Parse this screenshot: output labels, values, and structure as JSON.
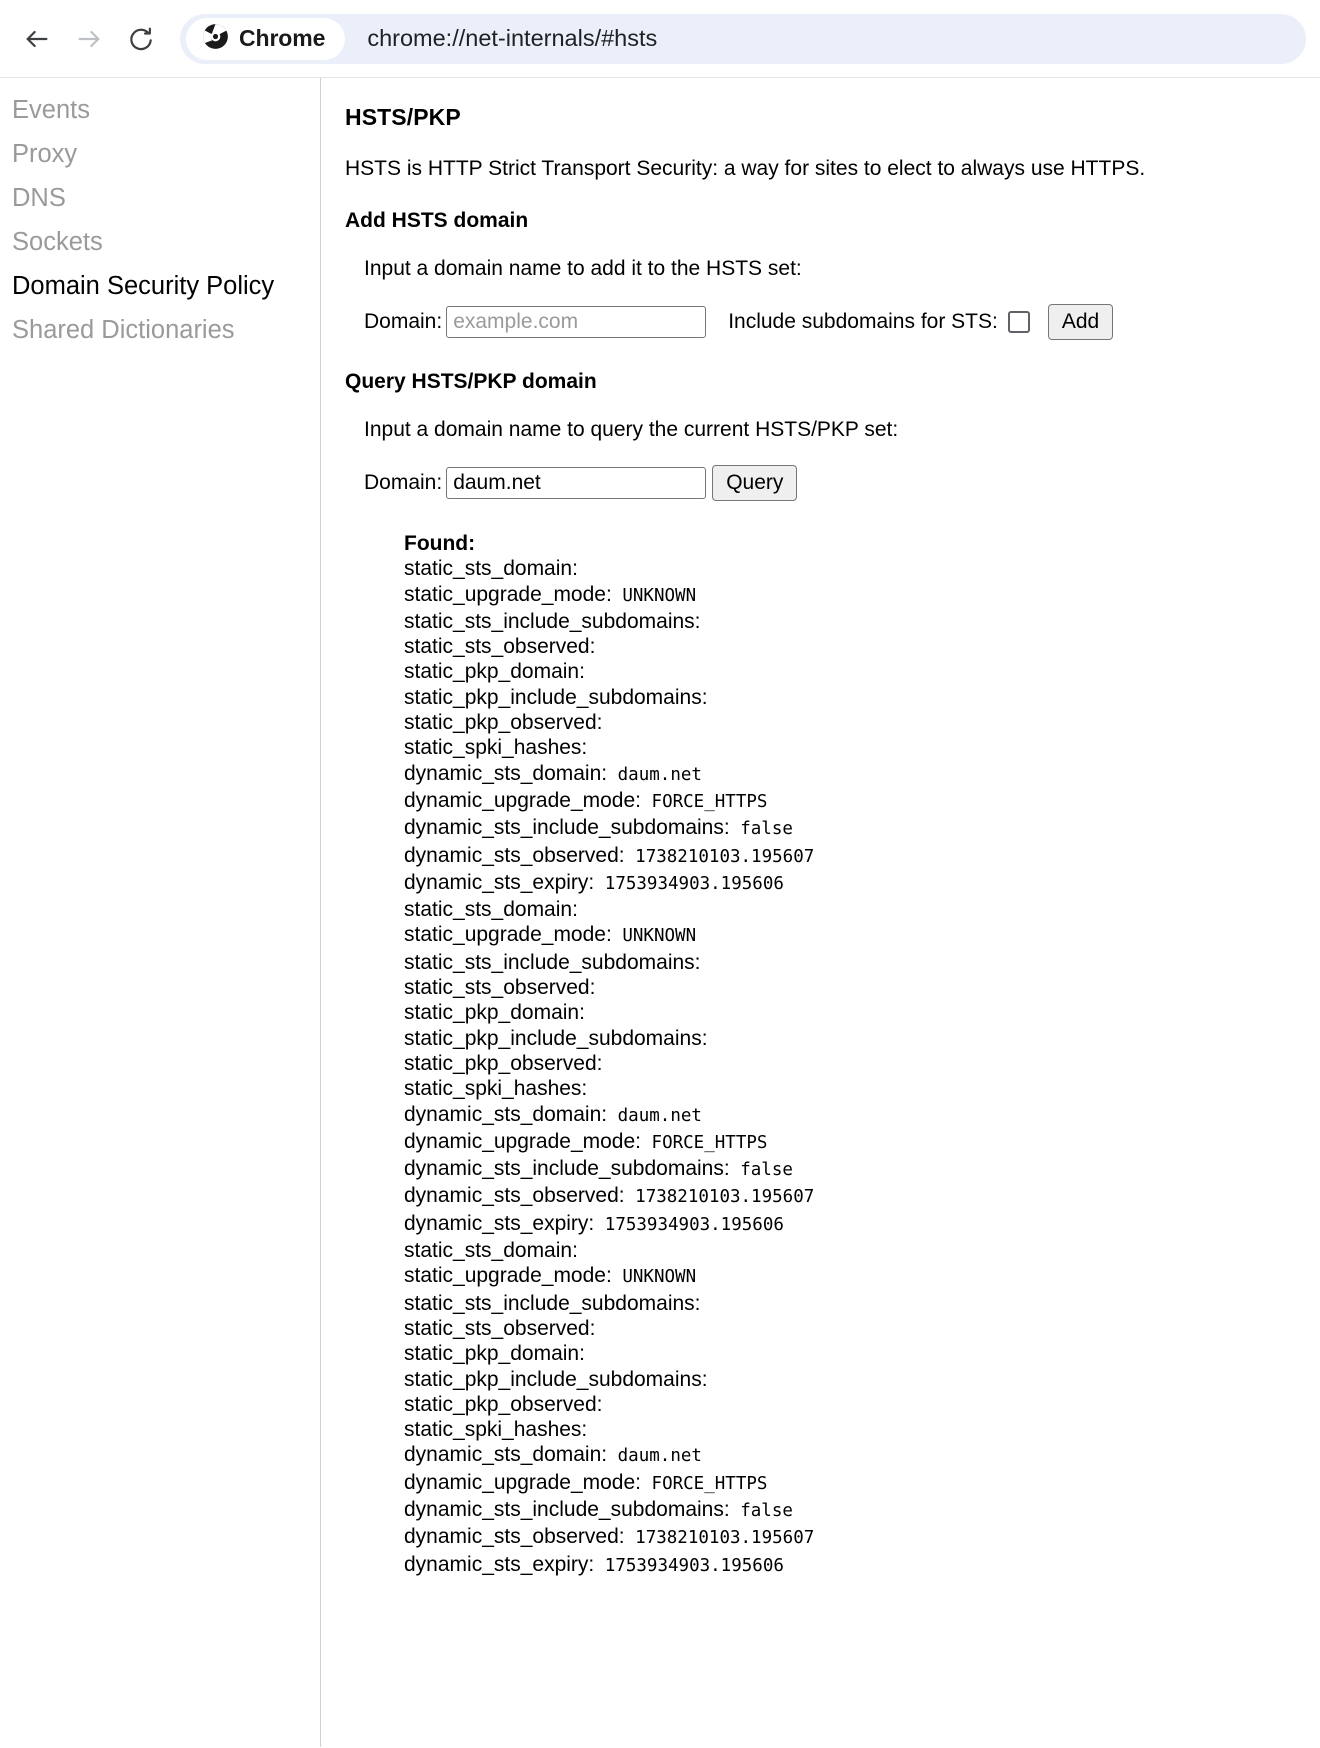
{
  "browser": {
    "back_icon": "arrow-left-icon",
    "forward_icon": "arrow-right-icon",
    "reload_icon": "reload-icon",
    "chrome_chip_label": "Chrome",
    "url": "chrome://net-internals/#hsts"
  },
  "sidebar": {
    "items": [
      {
        "label": "Events",
        "selected": false
      },
      {
        "label": "Proxy",
        "selected": false
      },
      {
        "label": "DNS",
        "selected": false
      },
      {
        "label": "Sockets",
        "selected": false
      },
      {
        "label": "Domain Security Policy",
        "selected": true
      },
      {
        "label": "Shared Dictionaries",
        "selected": false
      }
    ]
  },
  "main": {
    "title": "HSTS/PKP",
    "intro": "HSTS is HTTP Strict Transport Security: a way for sites to elect to always use HTTPS.",
    "add_section": {
      "heading": "Add HSTS domain",
      "hint": "Input a domain name to add it to the HSTS set:",
      "domain_label": "Domain:",
      "domain_placeholder": "example.com",
      "domain_value": "",
      "subdomains_label": "Include subdomains for STS:",
      "subdomains_checked": false,
      "add_button": "Add"
    },
    "query_section": {
      "heading": "Query HSTS/PKP domain",
      "hint": "Input a domain name to query the current HSTS/PKP set:",
      "domain_label": "Domain:",
      "domain_value": "daum.net",
      "query_button": "Query"
    },
    "result": {
      "found_label": "Found:",
      "lines": [
        {
          "key": "static_sts_domain:",
          "value": ""
        },
        {
          "key": "static_upgrade_mode:",
          "value": "UNKNOWN"
        },
        {
          "key": "static_sts_include_subdomains:",
          "value": ""
        },
        {
          "key": "static_sts_observed:",
          "value": ""
        },
        {
          "key": "static_pkp_domain:",
          "value": ""
        },
        {
          "key": "static_pkp_include_subdomains:",
          "value": ""
        },
        {
          "key": "static_pkp_observed:",
          "value": ""
        },
        {
          "key": "static_spki_hashes:",
          "value": ""
        },
        {
          "key": "dynamic_sts_domain:",
          "value": "daum.net"
        },
        {
          "key": "dynamic_upgrade_mode:",
          "value": "FORCE_HTTPS"
        },
        {
          "key": "dynamic_sts_include_subdomains:",
          "value": "false"
        },
        {
          "key": "dynamic_sts_observed:",
          "value": "1738210103.195607"
        },
        {
          "key": "dynamic_sts_expiry:",
          "value": "1753934903.195606"
        },
        {
          "key": "static_sts_domain:",
          "value": ""
        },
        {
          "key": "static_upgrade_mode:",
          "value": "UNKNOWN"
        },
        {
          "key": "static_sts_include_subdomains:",
          "value": ""
        },
        {
          "key": "static_sts_observed:",
          "value": ""
        },
        {
          "key": "static_pkp_domain:",
          "value": ""
        },
        {
          "key": "static_pkp_include_subdomains:",
          "value": ""
        },
        {
          "key": "static_pkp_observed:",
          "value": ""
        },
        {
          "key": "static_spki_hashes:",
          "value": ""
        },
        {
          "key": "dynamic_sts_domain:",
          "value": "daum.net"
        },
        {
          "key": "dynamic_upgrade_mode:",
          "value": "FORCE_HTTPS"
        },
        {
          "key": "dynamic_sts_include_subdomains:",
          "value": "false"
        },
        {
          "key": "dynamic_sts_observed:",
          "value": "1738210103.195607"
        },
        {
          "key": "dynamic_sts_expiry:",
          "value": "1753934903.195606"
        },
        {
          "key": "static_sts_domain:",
          "value": ""
        },
        {
          "key": "static_upgrade_mode:",
          "value": "UNKNOWN"
        },
        {
          "key": "static_sts_include_subdomains:",
          "value": ""
        },
        {
          "key": "static_sts_observed:",
          "value": ""
        },
        {
          "key": "static_pkp_domain:",
          "value": ""
        },
        {
          "key": "static_pkp_include_subdomains:",
          "value": ""
        },
        {
          "key": "static_pkp_observed:",
          "value": ""
        },
        {
          "key": "static_spki_hashes:",
          "value": ""
        },
        {
          "key": "dynamic_sts_domain:",
          "value": "daum.net"
        },
        {
          "key": "dynamic_upgrade_mode:",
          "value": "FORCE_HTTPS"
        },
        {
          "key": "dynamic_sts_include_subdomains:",
          "value": "false"
        },
        {
          "key": "dynamic_sts_observed:",
          "value": "1738210103.195607"
        },
        {
          "key": "dynamic_sts_expiry:",
          "value": "1753934903.195606"
        }
      ]
    }
  }
}
